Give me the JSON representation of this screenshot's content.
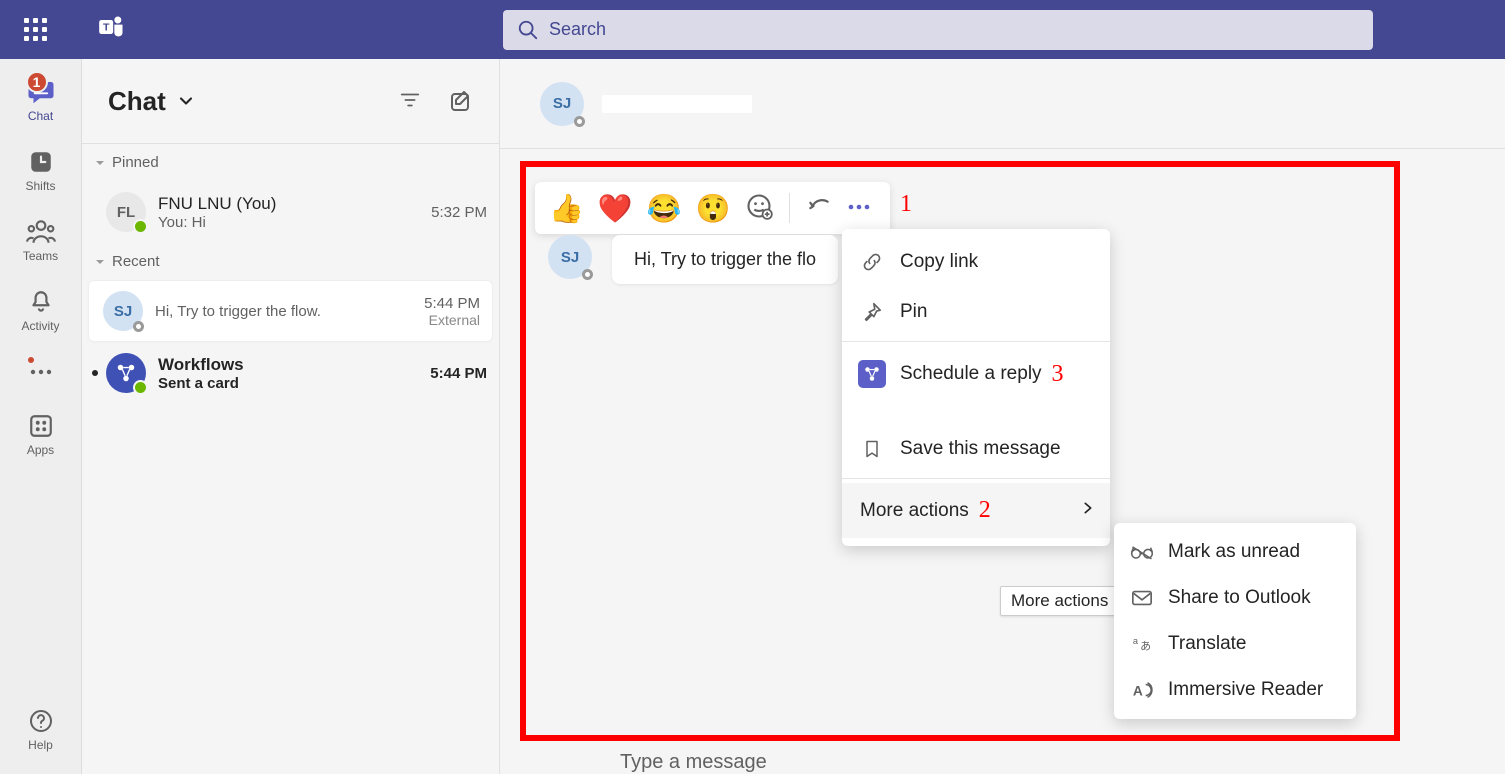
{
  "topbar": {
    "search_placeholder": "Search"
  },
  "rail": {
    "items": [
      {
        "label": "Chat",
        "badge": "1",
        "active": true
      },
      {
        "label": "Shifts"
      },
      {
        "label": "Teams"
      },
      {
        "label": "Activity"
      },
      {
        "label": "",
        "dot": true
      },
      {
        "label": "Apps"
      }
    ],
    "help_label": "Help"
  },
  "sidebar": {
    "title": "Chat",
    "sections": {
      "pinned": "Pinned",
      "recent": "Recent"
    },
    "chats": [
      {
        "title": "FNU LNU (You)",
        "sub": "You: Hi",
        "time": "5:32 PM",
        "avatar": "FL",
        "presence": "green"
      },
      {
        "title": "",
        "sub": "Hi, Try to trigger the flow.",
        "time": "5:44 PM",
        "extra": "External",
        "avatar": "SJ",
        "presence": "offline",
        "selected": true
      },
      {
        "title": "Workflows",
        "sub": "Sent a card",
        "time": "5:44 PM",
        "app": true,
        "bold": true,
        "bullet": true
      }
    ]
  },
  "content": {
    "header_avatar": "SJ",
    "message": {
      "avatar": "SJ",
      "text": "Hi, Try to trigger the flo"
    }
  },
  "context_menu": {
    "items": {
      "copy_link": "Copy link",
      "pin": "Pin",
      "schedule_reply": "Schedule a reply",
      "save": "Save this message",
      "more_actions": "More actions"
    }
  },
  "submenu": {
    "items": {
      "mark_unread": "Mark as unread",
      "share_outlook": "Share to Outlook",
      "translate": "Translate",
      "immersive": "Immersive Reader"
    }
  },
  "tooltip": {
    "more_actions": "More actions"
  },
  "compose": {
    "placeholder": "Type a message"
  },
  "annotations": {
    "n1": "1",
    "n2": "2",
    "n3": "3"
  }
}
